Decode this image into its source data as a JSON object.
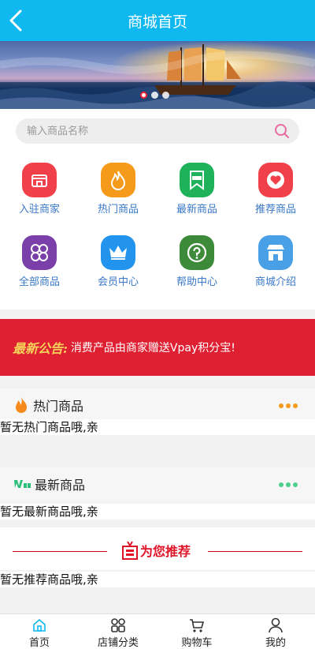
{
  "header": {
    "title": "商城首页"
  },
  "search": {
    "placeholder": "输入商品名称"
  },
  "grid": {
    "items": [
      {
        "label": "入驻商家",
        "color": "#f0414b",
        "icon": "shop-icon"
      },
      {
        "label": "热门商品",
        "color": "#f59a1b",
        "icon": "flame-icon"
      },
      {
        "label": "最新商品",
        "color": "#1fb25a",
        "icon": "new-badge-icon"
      },
      {
        "label": "推荐商品",
        "color": "#f0414b",
        "icon": "heart-icon"
      },
      {
        "label": "全部商品",
        "color": "#7a3fa8",
        "icon": "clover-icon"
      },
      {
        "label": "会员中心",
        "color": "#2394ee",
        "icon": "crown-icon"
      },
      {
        "label": "帮助中心",
        "color": "#3d8a3a",
        "icon": "help-icon"
      },
      {
        "label": "商城介绍",
        "color": "#4aa0e6",
        "icon": "store-icon"
      }
    ]
  },
  "notice": {
    "tag": "最新公告:",
    "text": "消费产品由商家赠送Vpay积分宝!"
  },
  "sections": {
    "hot": {
      "title": "热门商品",
      "empty": "暂无热门商品哦,亲"
    },
    "new": {
      "title": "最新商品",
      "empty": "暂无最新商品哦,亲"
    },
    "recommend": {
      "title": "为您推荐",
      "empty": "暂无推荐商品哦,亲"
    }
  },
  "tabbar": {
    "items": [
      {
        "label": "首页"
      },
      {
        "label": "店铺分类"
      },
      {
        "label": "购物车"
      },
      {
        "label": "我的"
      }
    ]
  },
  "colors": {
    "primary": "#0fb8ee",
    "notice": "#df2032",
    "accent": "#e01428"
  }
}
